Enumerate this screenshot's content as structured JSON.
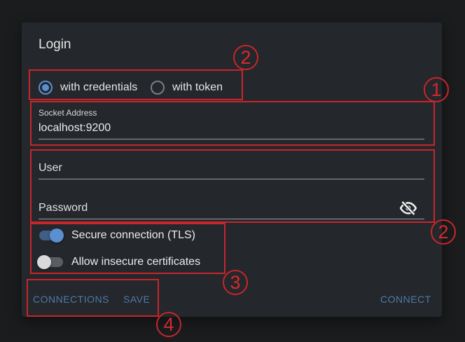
{
  "dialog": {
    "title": "Login"
  },
  "auth_mode": {
    "options": [
      {
        "label": "with credentials",
        "selected": true
      },
      {
        "label": "with token",
        "selected": false
      }
    ]
  },
  "socket_address": {
    "label": "Socket Address",
    "value": "localhost:9200"
  },
  "user": {
    "placeholder": "User",
    "value": ""
  },
  "password": {
    "placeholder": "Password",
    "value": "",
    "visibility_icon": "eye-off-icon"
  },
  "toggles": [
    {
      "label": "Secure connection (TLS)",
      "on": true
    },
    {
      "label": "Allow insecure certificates",
      "on": false
    }
  ],
  "buttons": {
    "connections": "CONNECTIONS",
    "save": "SAVE",
    "connect": "CONNECT"
  },
  "annotations": {
    "radio_group": "2",
    "socket_address": "1",
    "credentials": "2",
    "toggles": "3",
    "actions": "4"
  },
  "colors": {
    "background": "#1b1c1e",
    "dialog": "#24272b",
    "accent": "#5b8fd1",
    "button_text": "#4f79a8",
    "annotation": "#c8262b"
  }
}
